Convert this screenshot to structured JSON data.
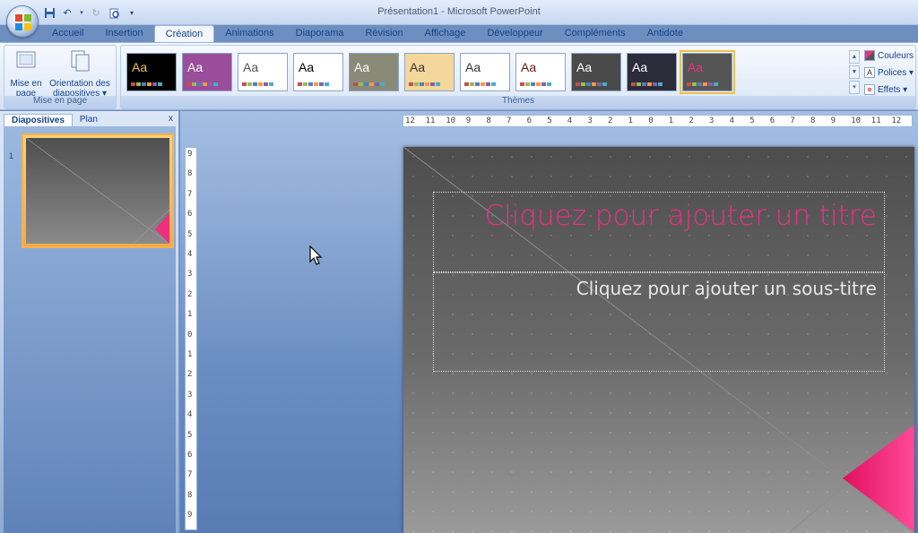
{
  "window": {
    "title": "Présentation1 - Microsoft PowerPoint"
  },
  "quick_access": {
    "icons": [
      "save-icon",
      "undo-icon",
      "redo-icon",
      "print-preview-icon",
      "customize-icon"
    ]
  },
  "tabs": [
    {
      "label": "Accueil"
    },
    {
      "label": "Insertion"
    },
    {
      "label": "Création",
      "active": true
    },
    {
      "label": "Animations"
    },
    {
      "label": "Diaporama"
    },
    {
      "label": "Révision"
    },
    {
      "label": "Affichage"
    },
    {
      "label": "Développeur"
    },
    {
      "label": "Compléments"
    },
    {
      "label": "Antidote"
    }
  ],
  "ribbon": {
    "page_setup": {
      "group_label": "Mise en page",
      "page_setup_label_1": "Mise en",
      "page_setup_label_2": "page",
      "orientation_label_1": "Orientation des",
      "orientation_label_2": "diapositives ▾"
    },
    "themes": {
      "group_label": "Thèmes",
      "items": [
        {
          "aa": "Aa",
          "bg": "#000000",
          "fg": "#f2c94c"
        },
        {
          "aa": "Aa",
          "bg": "#9a4d9b",
          "fg": "#ffffff"
        },
        {
          "aa": "Aa",
          "bg": "#ffffff",
          "fg": "#555555"
        },
        {
          "aa": "Aa",
          "bg": "#ffffff",
          "fg": "#000000"
        },
        {
          "aa": "Aa",
          "bg": "#8a8a78",
          "fg": "#ffffff"
        },
        {
          "aa": "Aa",
          "bg": "#f4d79a",
          "fg": "#333333"
        },
        {
          "aa": "Aa",
          "bg": "#ffffff",
          "fg": "#333333"
        },
        {
          "aa": "Aa",
          "bg": "#ffffff",
          "fg": "#5b1b1b"
        },
        {
          "aa": "Aa",
          "bg": "#4a4a4a",
          "fg": "#ffffff"
        },
        {
          "aa": "Aa",
          "bg": "#2b2b3a",
          "fg": "#ffffff"
        },
        {
          "aa": "Aa",
          "bg": "#555555",
          "fg": "#ef2f7d",
          "selected": true
        }
      ]
    },
    "theme_options": {
      "colors_label": "Couleurs",
      "fonts_label": "Polices ▾",
      "effects_label": "Effets ▾"
    }
  },
  "left_pane": {
    "tab_slides": "Diapositives",
    "tab_outline": "Plan",
    "close": "x",
    "slide_number": "1"
  },
  "slide": {
    "title_placeholder": "Cliquez pour ajouter un titre",
    "subtitle_placeholder": "Cliquez pour ajouter un sous-titre",
    "accent_color": "#ef2f7d"
  },
  "hruler_labels": [
    "12",
    "11",
    "10",
    "9",
    "8",
    "7",
    "6",
    "5",
    "4",
    "3",
    "2",
    "1",
    "0",
    "1",
    "2",
    "3",
    "4",
    "5",
    "6",
    "7",
    "8",
    "9",
    "10",
    "11",
    "12"
  ],
  "vruler_labels": [
    "9",
    "8",
    "7",
    "6",
    "5",
    "4",
    "3",
    "2",
    "1",
    "0",
    "1",
    "2",
    "3",
    "4",
    "5",
    "6",
    "7",
    "8",
    "9"
  ]
}
